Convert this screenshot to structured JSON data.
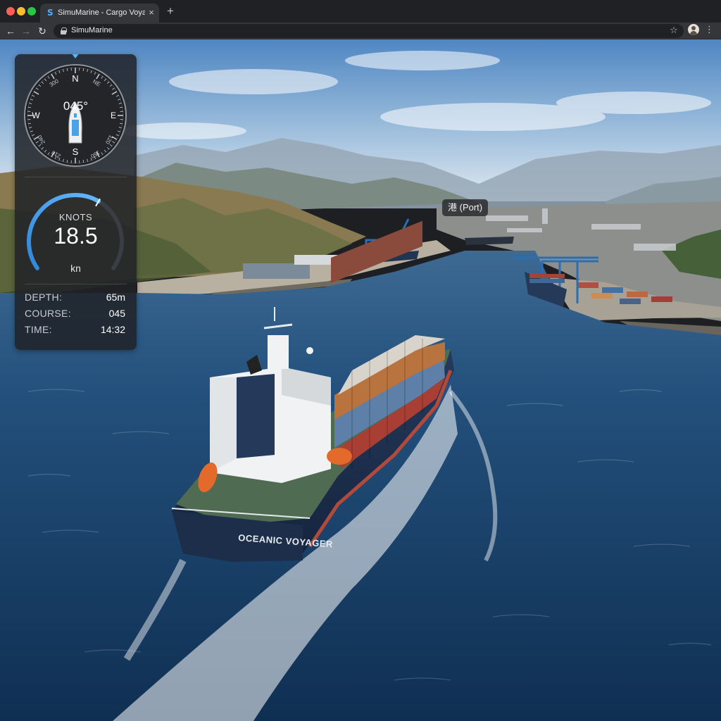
{
  "browser": {
    "tab_title": "SimuMarine - Cargo Voyage",
    "favicon": "S",
    "close_glyph": "×",
    "new_tab_glyph": "+",
    "url": "SimuMarine",
    "back_glyph": "←",
    "forward_glyph": "→",
    "reload_glyph": "↻",
    "star_glyph": "☆",
    "menu_glyph": "⋮"
  },
  "scene": {
    "ship_name": "OCEANIC VOYAGER",
    "port_label": "港 (Port)"
  },
  "hud": {
    "compass": {
      "heading_display": "045°",
      "heading_deg": 45,
      "cardinals": {
        "n": "N",
        "e": "E",
        "s": "S",
        "w": "W"
      },
      "degree_labels": [
        "300",
        "NE",
        "120",
        "150",
        "210",
        "240"
      ]
    },
    "speed": {
      "label": "KNOTS",
      "value": "18.5",
      "unit": "kn",
      "gauge_fraction": 0.62
    },
    "stats": [
      {
        "label": "DEPTH:",
        "value": "65m"
      },
      {
        "label": "COURSE:",
        "value": "045"
      },
      {
        "label": "TIME:",
        "value": "14:32"
      }
    ]
  },
  "colors": {
    "accent": "#4a9eea",
    "hud_bg": "#202226"
  }
}
